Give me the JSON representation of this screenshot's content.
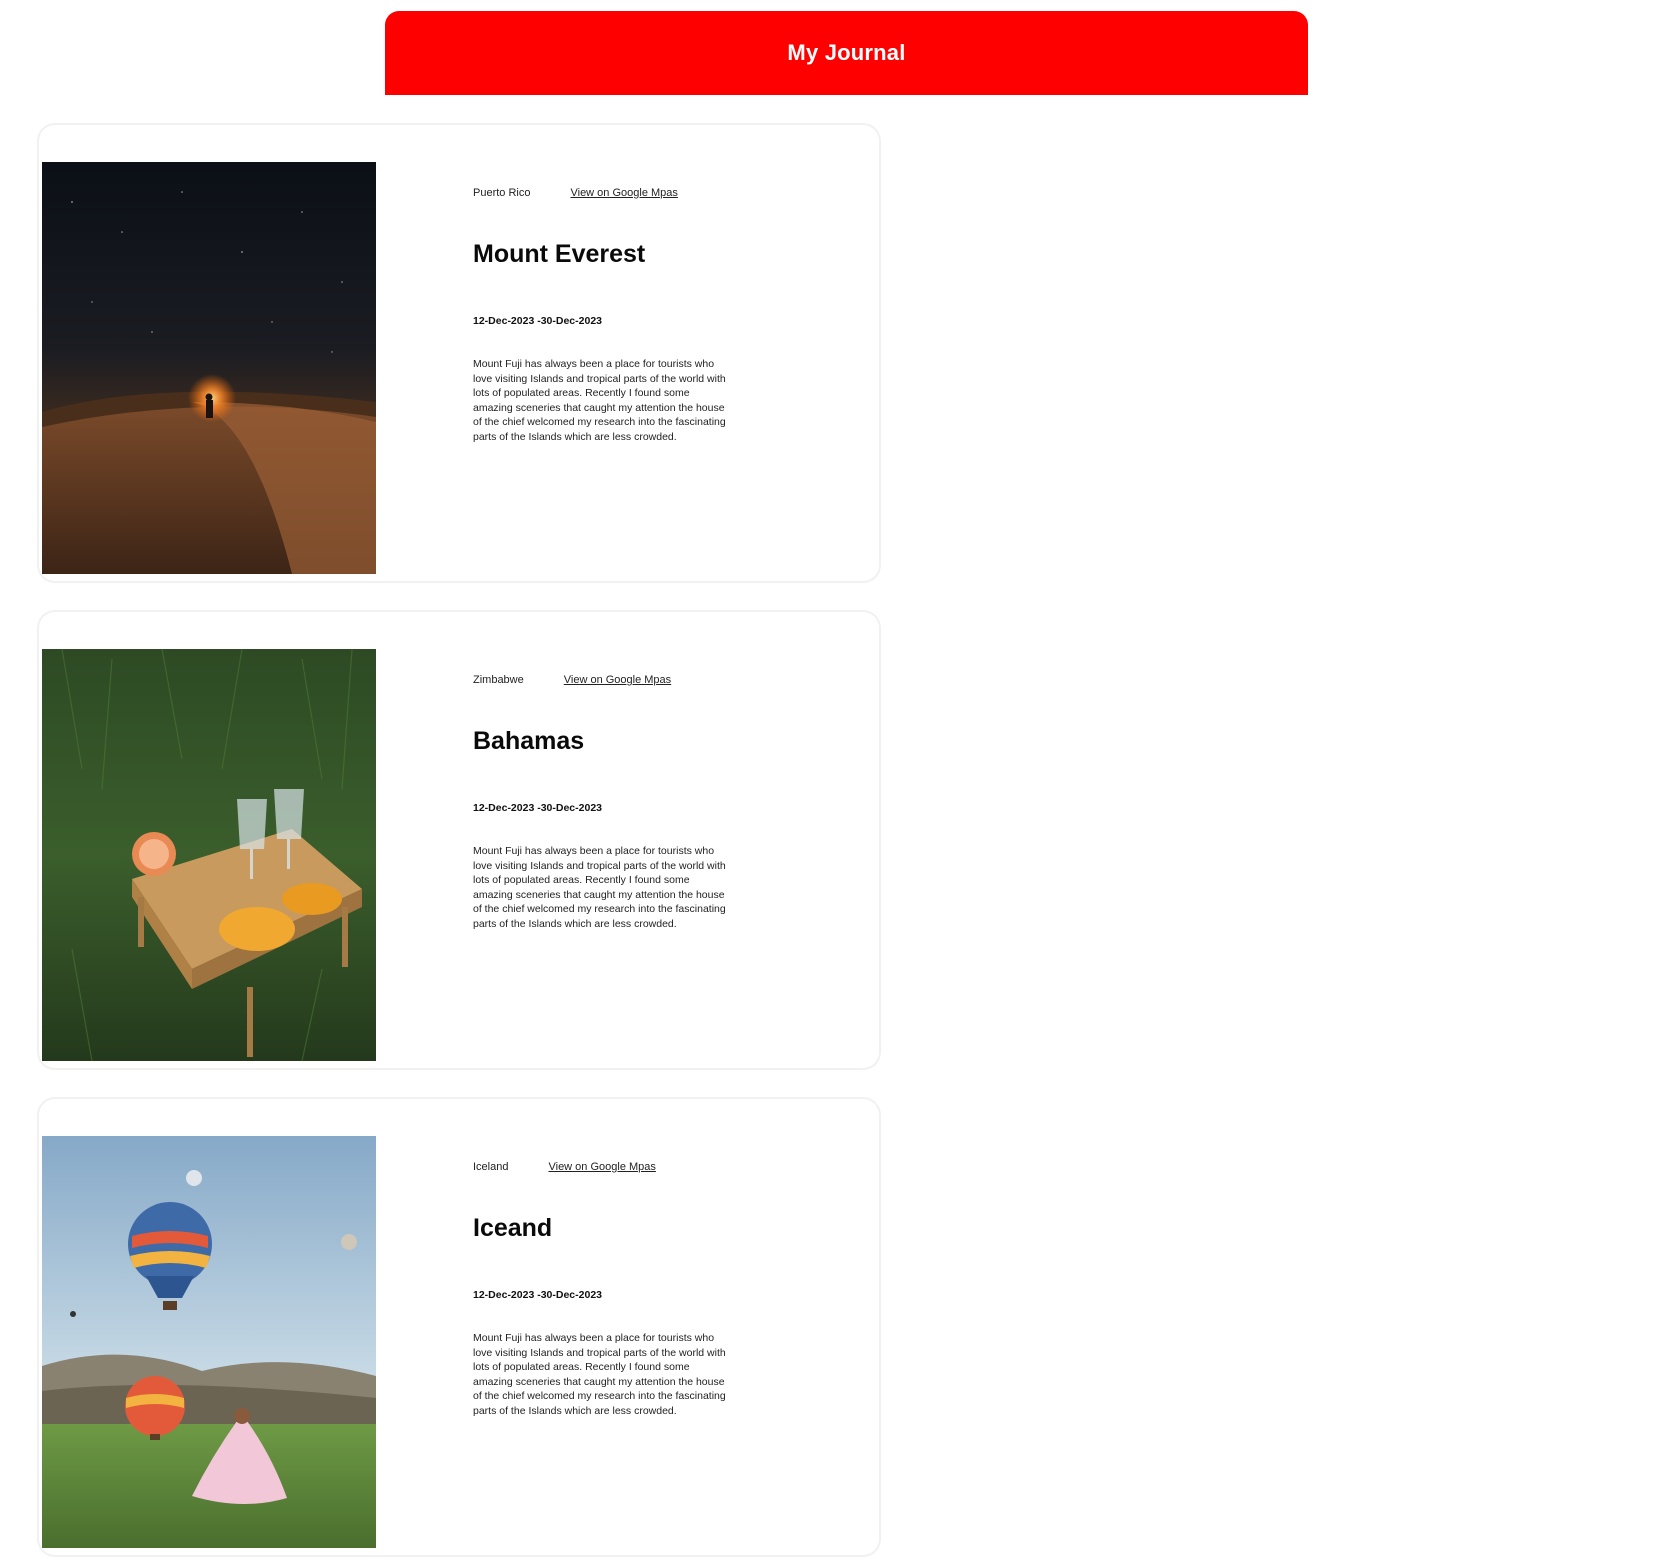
{
  "header": {
    "title": "My Journal",
    "background_color": "#ff0000"
  },
  "entries": [
    {
      "location": "Puerto Rico",
      "maps_link_label": "View on Google Mpas",
      "title": "Mount Everest",
      "dates": "12-Dec-2023 -30-Dec-2023",
      "description": "Mount Fuji has always been a place for tourists who love visiting Islands and tropical parts of the world with lots of populated areas. Recently I found some amazing sceneries that caught my attention the house of the chief welcomed my research into the fascinating parts of the Islands which are less crowded.",
      "photo_icon": "desert-night-photo"
    },
    {
      "location": "Zimbabwe",
      "maps_link_label": "View on Google Mpas",
      "title": "Bahamas",
      "dates": "12-Dec-2023 -30-Dec-2023",
      "description": "Mount Fuji has always been a place for tourists who love visiting Islands and tropical parts of the world with lots of populated areas. Recently I found some amazing sceneries that caught my attention the house of the chief welcomed my research into the fascinating parts of the Islands which are less crowded.",
      "photo_icon": "picnic-photo"
    },
    {
      "location": "Iceland",
      "maps_link_label": "View on Google Mpas",
      "title": "Iceand",
      "dates": "12-Dec-2023 -30-Dec-2023",
      "description": "Mount Fuji has always been a place for tourists who love visiting Islands and tropical parts of the world with lots of populated areas. Recently I found some amazing sceneries that caught my attention the house of the chief welcomed my research into the fascinating parts of the Islands which are less crowded.",
      "photo_icon": "hot-air-balloons-photo"
    }
  ]
}
